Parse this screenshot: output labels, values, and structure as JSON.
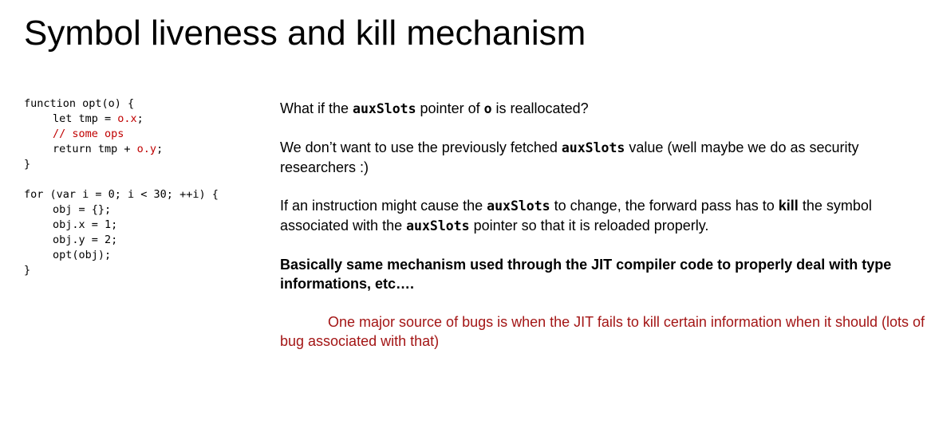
{
  "slide": {
    "title": "Symbol liveness and kill mechanism"
  },
  "code": {
    "l1": "function opt(o) {",
    "l2a": "let tmp = ",
    "l2b": "o.x",
    "l2c": ";",
    "l3": "// some ops",
    "l4a": "return tmp + ",
    "l4b": "o.y",
    "l4c": ";",
    "l5": "}",
    "l6": "for (var i = 0; i < 30; ++i) {",
    "l7": "obj = {};",
    "l8": "obj.x = 1;",
    "l9": "obj.y = 2;",
    "l10": "opt(obj);",
    "l11": "}"
  },
  "notes": {
    "p1": {
      "a": "What if the ",
      "code1": "auxSlots",
      "b": " pointer of ",
      "code2": "o",
      "c": " is reallocated?"
    },
    "p2": {
      "a": "We don’t want to use the previously fetched ",
      "code1": "auxSlots",
      "b": " value (well maybe we do as security researchers :)"
    },
    "p3": {
      "a": "If an instruction might cause the ",
      "code1": "auxSlots",
      "b": " to change, the forward pass has to ",
      "kill": "kill",
      "c": " the symbol associated with the ",
      "code2": "auxSlots",
      "d": " pointer so that it is reloaded properly."
    },
    "p4": "Basically same mechanism used through the JIT compiler code to properly deal with type informations, etc….",
    "p5": "One major source of bugs is when the JIT fails to kill certain information when it should (lots of bug associated with that)"
  },
  "colors": {
    "code_highlight": "#c00000",
    "note_text": "#a31515"
  }
}
